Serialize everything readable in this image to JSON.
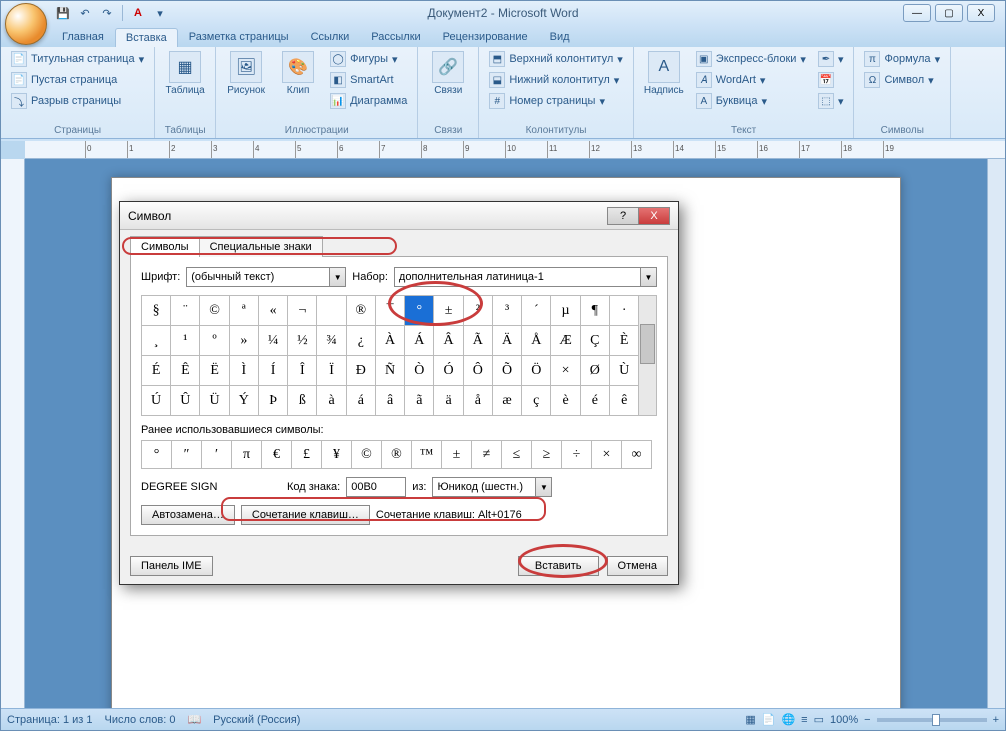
{
  "title": "Документ2 - Microsoft Word",
  "qat": {
    "save": "💾",
    "undo": "↶",
    "redo": "↷",
    "font_a": "A"
  },
  "win_controls": {
    "min": "—",
    "max": "▢",
    "close": "X"
  },
  "tabs": [
    "Главная",
    "Вставка",
    "Разметка страницы",
    "Ссылки",
    "Рассылки",
    "Рецензирование",
    "Вид"
  ],
  "active_tab": 1,
  "ribbon": {
    "pages": {
      "label": "Страницы",
      "title_page": "Титульная страница",
      "blank_page": "Пустая страница",
      "page_break": "Разрыв страницы"
    },
    "tables": {
      "label": "Таблицы",
      "table": "Таблица"
    },
    "illustr": {
      "label": "Иллюстрации",
      "picture": "Рисунок",
      "clip": "Клип",
      "shapes": "Фигуры",
      "smartart": "SmartArt",
      "chart": "Диаграмма"
    },
    "links": {
      "label": "Связи",
      "links": "Связи"
    },
    "headers": {
      "label": "Колонтитулы",
      "header": "Верхний колонтитул",
      "footer": "Нижний колонтитул",
      "pagenum": "Номер страницы"
    },
    "text": {
      "label": "Текст",
      "textbox": "Надпись",
      "quickparts": "Экспресс-блоки",
      "wordart": "WordArt",
      "dropcap": "Буквица"
    },
    "symbols": {
      "label": "Символы",
      "equation": "Формула",
      "symbol": "Символ"
    }
  },
  "status_bar": {
    "page": "Страница: 1 из 1",
    "words": "Число слов: 0",
    "lang": "Русский (Россия)",
    "zoom": "100%"
  },
  "dialog": {
    "title": "Символ",
    "tabs": {
      "symbols": "Символы",
      "special": "Специальные знаки"
    },
    "font_label": "Шрифт:",
    "font_value": "(обычный текст)",
    "subset_label": "Набор:",
    "subset_value": "дополнительная латиница-1",
    "grid": [
      [
        "§",
        "¨",
        "©",
        "ª",
        "«",
        "¬",
        "­",
        "®",
        "¯",
        "°",
        "±",
        "²",
        "³",
        "´",
        "µ",
        "¶",
        "·"
      ],
      [
        "¸",
        "¹",
        "º",
        "»",
        "¼",
        "½",
        "¾",
        "¿",
        "À",
        "Á",
        "Â",
        "Ã",
        "Ä",
        "Å",
        "Æ",
        "Ç",
        "È"
      ],
      [
        "É",
        "Ê",
        "Ë",
        "Ì",
        "Í",
        "Î",
        "Ï",
        "Ð",
        "Ñ",
        "Ò",
        "Ó",
        "Ô",
        "Õ",
        "Ö",
        "×",
        "Ø",
        "Ù"
      ],
      [
        "Ú",
        "Û",
        "Ü",
        "Ý",
        "Þ",
        "ß",
        "à",
        "á",
        "â",
        "ã",
        "ä",
        "å",
        "æ",
        "ç",
        "è",
        "é",
        "ê"
      ]
    ],
    "selected": [
      0,
      9
    ],
    "recent_label": "Ранее использовавшиеся символы:",
    "recent": [
      "°",
      "″",
      "′",
      "π",
      "€",
      "£",
      "¥",
      "©",
      "®",
      "™",
      "±",
      "≠",
      "≤",
      "≥",
      "÷",
      "×",
      "∞"
    ],
    "char_name": "DEGREE SIGN",
    "code_label": "Код знака:",
    "code_value": "00B0",
    "from_label": "из:",
    "from_value": "Юникод (шестн.)",
    "autocorrect": "Автозамена…",
    "shortcut_btn": "Сочетание клавиш…",
    "shortcut_text": "Сочетание клавиш: Alt+0176",
    "ime": "Панель IME",
    "insert": "Вставить",
    "cancel": "Отмена",
    "help": "?",
    "close": "X"
  }
}
